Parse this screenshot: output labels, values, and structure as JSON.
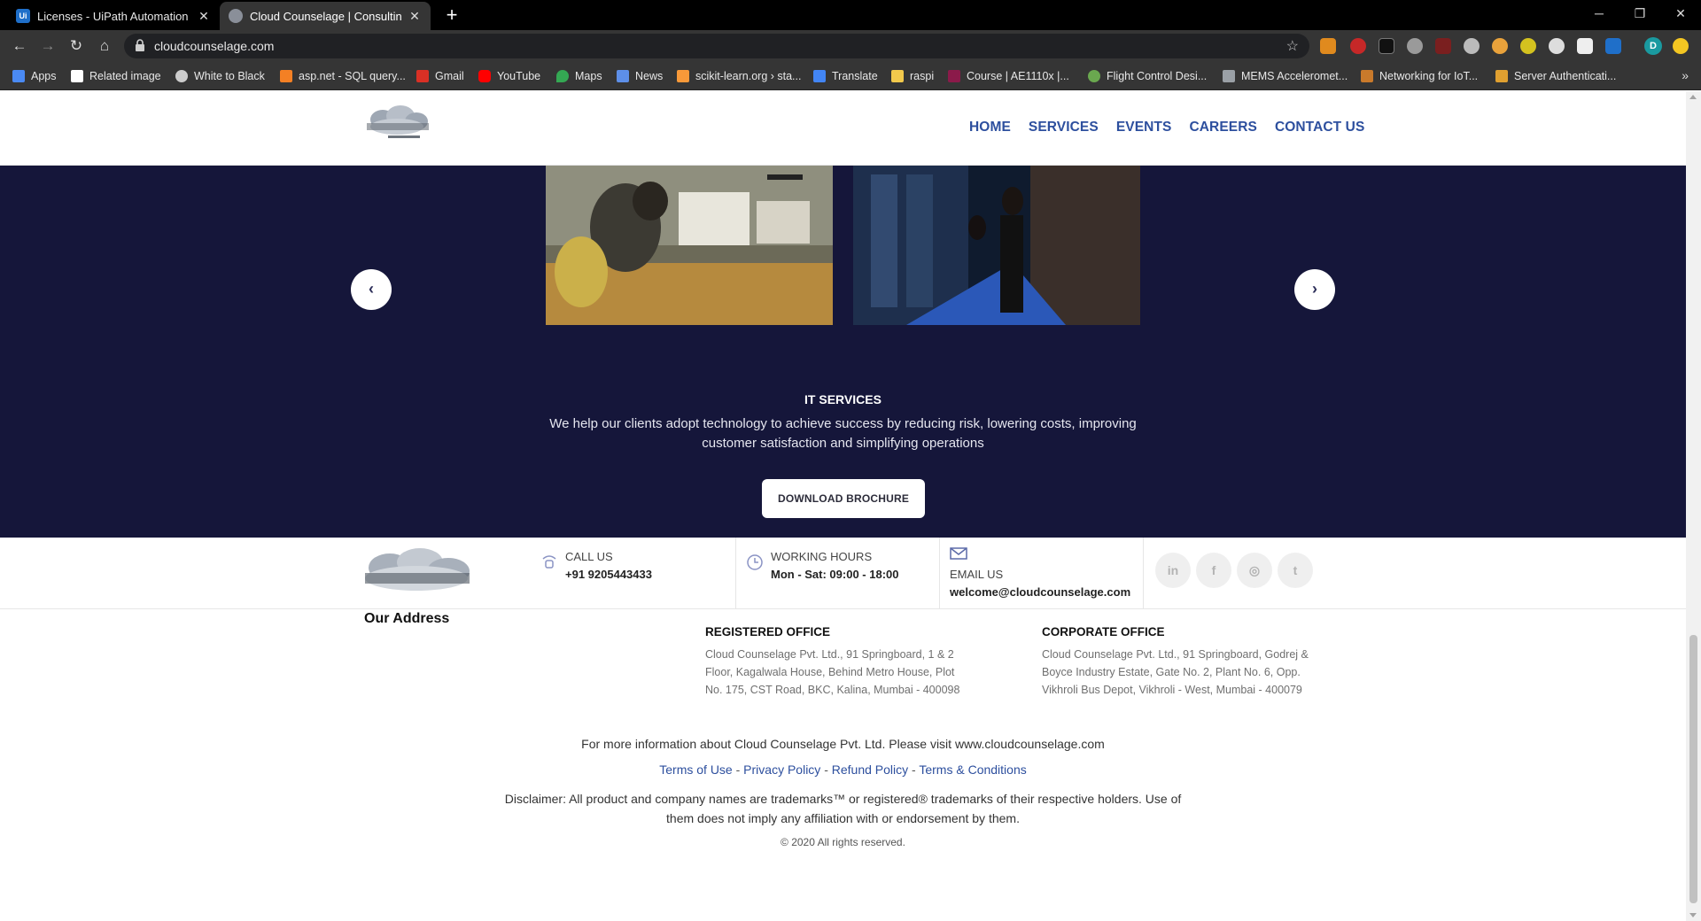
{
  "browser": {
    "tabs": [
      {
        "title": "Licenses - UiPath Automation Cl",
        "favicon": "uipath-icon",
        "active": false
      },
      {
        "title": "Cloud Counselage | Consulting, A",
        "favicon": "cloud-icon",
        "active": true
      }
    ],
    "url": "cloudcounselage.com",
    "profile_initial": "D",
    "bookmarks": [
      "Apps",
      "Related image",
      "White to Black",
      "asp.net - SQL query...",
      "Gmail",
      "YouTube",
      "Maps",
      "News",
      "scikit-learn.org › sta...",
      "Translate",
      "raspi",
      "Course | AE1110x |...",
      "Flight Control Desi...",
      "MEMS Acceleromet...",
      "Networking for IoT...",
      "Server Authenticati..."
    ]
  },
  "site": {
    "nav": [
      "HOME",
      "SERVICES",
      "EVENTS",
      "CAREERS",
      "CONTACT US"
    ],
    "hero": {
      "title": "IT SERVICES",
      "description": "We help our clients adopt technology to achieve success by reducing risk, lowering costs, improving customer satisfaction and simplifying operations",
      "button": "DOWNLOAD BROCHURE"
    },
    "contact": {
      "call_label": "CALL US",
      "call_value": "+91 9205443433",
      "hours_label": "WORKING HOURS",
      "hours_value": "Mon - Sat: 09:00 - 18:00",
      "email_label": "EMAIL US",
      "email_value": "welcome@cloudcounselage.com",
      "social": [
        "in",
        "f",
        "◎",
        "t"
      ]
    },
    "address": {
      "heading": "Our Address",
      "registered_title": "REGISTERED OFFICE",
      "registered_text": "Cloud Counselage Pvt. Ltd., 91 Springboard, 1 & 2 Floor, Kagalwala House, Behind Metro House, Plot No. 175, CST Road, BKC, Kalina, Mumbai - 400098",
      "corporate_title": "CORPORATE OFFICE",
      "corporate_text": "Cloud Counselage Pvt. Ltd., 91 Springboard, Godrej & Boyce Industry Estate, Gate No. 2, Plant No. 6, Opp. Vikhroli Bus Depot, Vikhroli - West, Mumbai - 400079"
    },
    "footer": {
      "more_info": "For more information about Cloud Counselage Pvt. Ltd. Please visit www.cloudcounselage.com",
      "links": [
        "Terms of Use",
        "Privacy Policy",
        "Refund Policy",
        "Terms & Conditions"
      ],
      "separator": " - ",
      "disclaimer": "Disclaimer: All product and company names are trademarks™ or registered® trademarks of their respective holders. Use of them does not imply any affiliation with or endorsement by them.",
      "copyright": "© 2020 All rights reserved."
    },
    "colors": {
      "hero_bg": "#15163a",
      "nav_link": "#2d4f9e"
    }
  }
}
